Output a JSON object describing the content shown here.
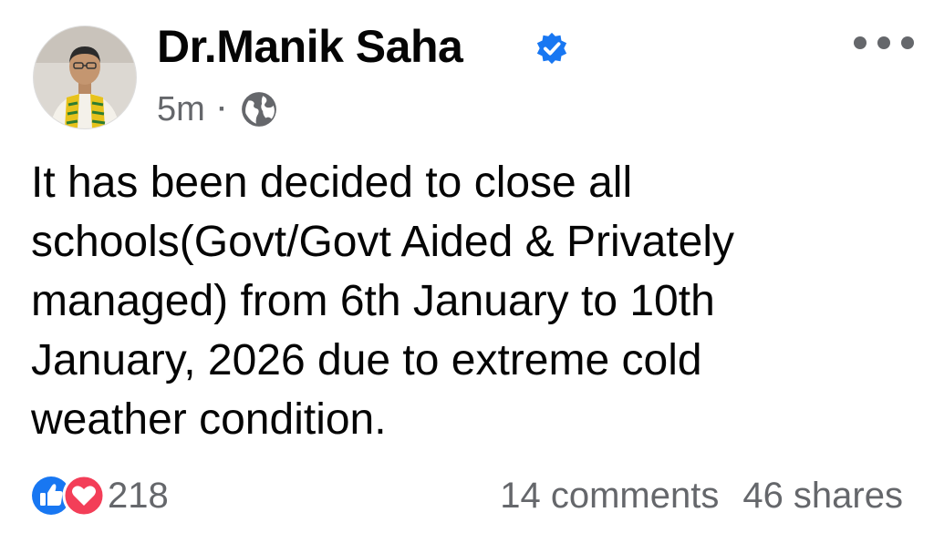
{
  "post": {
    "author": {
      "name": "Dr.Manik Saha",
      "verified": true,
      "verified_color": "#1877f2"
    },
    "meta": {
      "time": "5m",
      "separator": "·",
      "audience_icon": "globe-icon"
    },
    "text_lines": [
      "It has been decided to close all",
      "schools(Govt/Govt Aided & Privately",
      "managed) from 6th January to 10th",
      "January, 2026 due to extreme cold",
      "weather condition."
    ],
    "reactions": {
      "icons": [
        "like-icon",
        "love-icon"
      ],
      "like_color": "#1877f2",
      "love_color": "#f33e58",
      "count": "218"
    },
    "stats": {
      "comments": "14 comments",
      "shares": "46 shares"
    }
  }
}
